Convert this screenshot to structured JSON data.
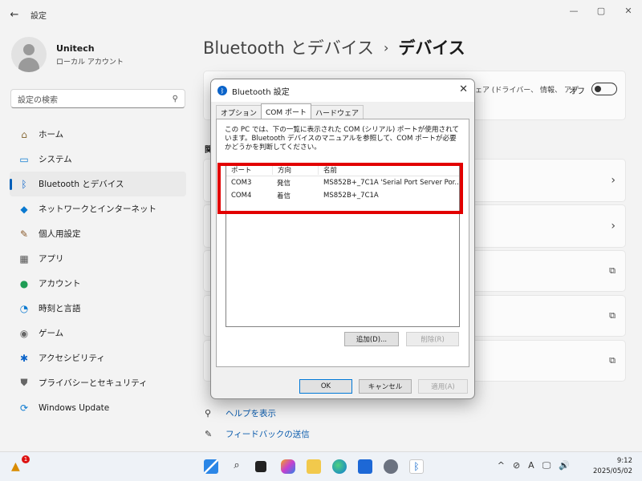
{
  "window": {
    "title": "設定",
    "back_icon": "←",
    "minimize": "—",
    "maximize": "▢",
    "close": "✕"
  },
  "profile": {
    "name": "Unitech",
    "account_type": "ローカル アカウント"
  },
  "search": {
    "placeholder": "設定の検索",
    "icon": "⚲"
  },
  "nav": {
    "items": [
      {
        "label": "ホーム",
        "icon": "⌂"
      },
      {
        "label": "システム",
        "icon": "▭"
      },
      {
        "label": "Bluetooth とデバイス",
        "icon": "ᛒ"
      },
      {
        "label": "ネットワークとインターネット",
        "icon": "◆"
      },
      {
        "label": "個人用設定",
        "icon": "✎"
      },
      {
        "label": "アプリ",
        "icon": "▦"
      },
      {
        "label": "アカウント",
        "icon": "●"
      },
      {
        "label": "時刻と言語",
        "icon": "◔"
      },
      {
        "label": "ゲーム",
        "icon": "◉"
      },
      {
        "label": "アクセシビリティ",
        "icon": "✱"
      },
      {
        "label": "プライバシーとセキュリティ",
        "icon": "⛊"
      },
      {
        "label": "Windows Update",
        "icon": "⟳"
      }
    ]
  },
  "breadcrumb": {
    "parent": "Bluetooth とデバイス",
    "separator": "›",
    "current": "デバイス"
  },
  "top_row": {
    "text": "ェア (ドライバー、 情報、 アプ",
    "state": "オフ"
  },
  "section_fragment": "関",
  "links": {
    "help": "ヘルプを表示",
    "feedback": "フィードバックの送信",
    "help_icon": "⚲",
    "feedback_icon": "✎"
  },
  "dialog": {
    "title": "Bluetooth 設定",
    "close": "✕",
    "tabs": [
      "オプション",
      "COM ポート",
      "ハードウェア"
    ],
    "description": "この PC では、下の一覧に表示された COM (シリアル) ポートが使用されています。Bluetooth デバイスのマニュアルを参照して、COM ポートが必要かどうかを判断してください。",
    "columns": [
      "ポート",
      "方向",
      "名前"
    ],
    "rows": [
      {
        "port": "COM3",
        "direction": "発信",
        "name": "MS852B+_7C1A 'Serial Port Server Por..."
      },
      {
        "port": "COM4",
        "direction": "着信",
        "name": "MS852B+_7C1A"
      }
    ],
    "add_button": "追加(D)...",
    "remove_button": "削除(R)",
    "ok_button": "OK",
    "cancel_button": "キャンセル",
    "apply_button": "適用(A)"
  },
  "taskbar": {
    "notification_count": "1",
    "tray_icons": [
      "^",
      "⊘",
      "A",
      "🖵",
      "🔊"
    ],
    "time": "9:12",
    "date": "2025/05/02"
  },
  "colors": {
    "accent": "#005fb8",
    "highlight": "#e20000"
  }
}
